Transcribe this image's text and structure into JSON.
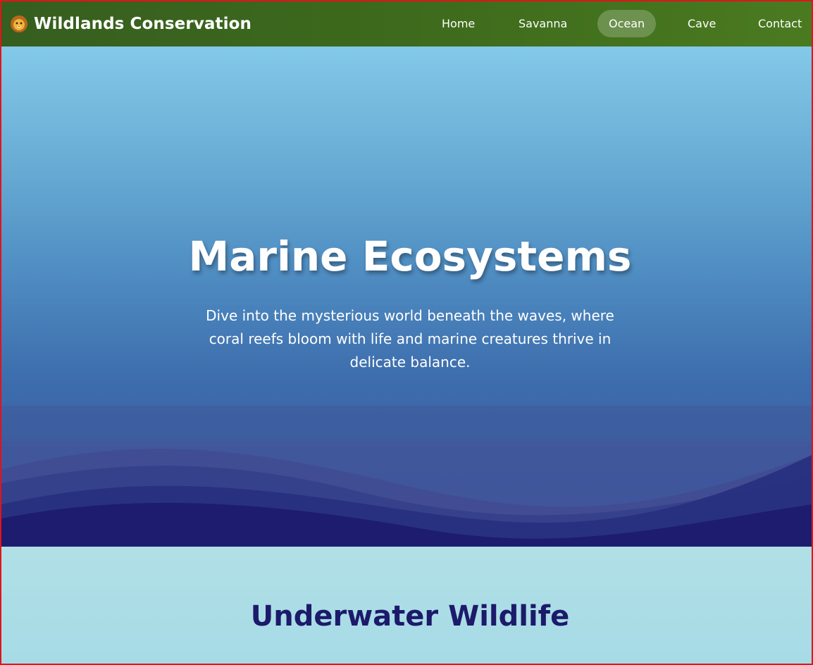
{
  "brand": {
    "name": "Wildlands Conservation",
    "logo_icon": "lion-icon"
  },
  "nav": {
    "items": [
      {
        "label": "Home",
        "active": false
      },
      {
        "label": "Savanna",
        "active": false
      },
      {
        "label": "Ocean",
        "active": true
      },
      {
        "label": "Cave",
        "active": false
      },
      {
        "label": "Contact",
        "active": false
      }
    ]
  },
  "hero": {
    "title": "Marine Ecosystems",
    "text": "Dive into the mysterious world beneath the waves, where coral reefs bloom with life and marine creatures thrive in delicate balance."
  },
  "section": {
    "title": "Underwater Wildlife"
  },
  "colors": {
    "nav_green": "#3d6a1c",
    "ocean_top": "#83c9e8",
    "ocean_deep": "#1c1a6b",
    "section_bg": "#a6dbe6",
    "frame_border": "#e0141c"
  }
}
